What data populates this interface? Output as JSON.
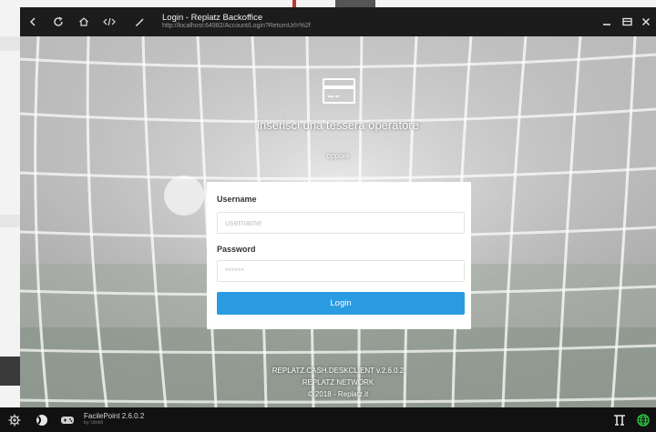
{
  "window": {
    "title": "Login - Replatz Backoffice",
    "url": "http://localhost:64982/Account/Login?ReturnUrl=%2f",
    "nav_icons": [
      "back-icon",
      "refresh-icon",
      "home-icon",
      "code-icon",
      "edit-icon"
    ],
    "controls": [
      "minimize-icon",
      "maximize-icon",
      "close-icon"
    ]
  },
  "login": {
    "card_prompt": "inserisci una tessera operatore",
    "oppure": "oppure",
    "username_label": "Username",
    "username_placeholder": "username",
    "password_label": "Password",
    "password_placeholder": "******",
    "login_button": "Login"
  },
  "footer": {
    "version": "REPLATZ.CASH.DESKCLIENT v.2.6.0.2",
    "network": "REPLATZ NETWORK",
    "copyright": "© 2018 - Replatz.it"
  },
  "taskbar": {
    "app_name": "FacilePoint  2.6.0.2",
    "by": "by Ubikit",
    "status_color": "#2ecc40"
  },
  "colors": {
    "accent": "#2a9be0",
    "titlebar": "#1c1c1c"
  }
}
